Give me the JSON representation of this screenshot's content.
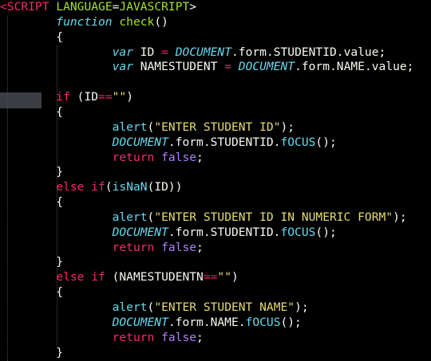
{
  "editor": {
    "theme_colors": {
      "background": "#000000",
      "tag": "#f92672",
      "function": "#a6e22e",
      "storage": "#66d9ef",
      "string": "#e6db74",
      "constant": "#ae81ff",
      "plain": "#f8f8f2",
      "current_line": "#3a3d41"
    },
    "lines": [
      [
        {
          "t": "tag",
          "v": "<SCRIPT"
        },
        {
          "t": "plain",
          "v": " "
        },
        {
          "t": "attr",
          "v": "LANGUAGE"
        },
        {
          "t": "plain",
          "v": "="
        },
        {
          "t": "attr",
          "v": "JAVASCRIPT"
        },
        {
          "t": "plain",
          "v": ">"
        }
      ],
      [
        {
          "t": "plain",
          "v": "        "
        },
        {
          "t": "store",
          "v": "function"
        },
        {
          "t": "plain",
          "v": " "
        },
        {
          "t": "fn",
          "v": "check"
        },
        {
          "t": "plain",
          "v": "()"
        }
      ],
      [
        {
          "t": "plain",
          "v": "        {"
        }
      ],
      [
        {
          "t": "plain",
          "v": "                "
        },
        {
          "t": "store",
          "v": "var"
        },
        {
          "t": "plain",
          "v": " ID "
        },
        {
          "t": "op",
          "v": "="
        },
        {
          "t": "plain",
          "v": " "
        },
        {
          "t": "var",
          "v": "DOCUMENT"
        },
        {
          "t": "plain",
          "v": ".form.STUDENTID.value;"
        }
      ],
      [
        {
          "t": "plain",
          "v": "                "
        },
        {
          "t": "store",
          "v": "var"
        },
        {
          "t": "plain",
          "v": " NAMESTUDENT "
        },
        {
          "t": "op",
          "v": "="
        },
        {
          "t": "plain",
          "v": " "
        },
        {
          "t": "var",
          "v": "DOCUMENT"
        },
        {
          "t": "plain",
          "v": ".form.NAME.value;"
        }
      ],
      [],
      [
        {
          "t": "plain",
          "v": "        "
        },
        {
          "t": "kw",
          "v": "if"
        },
        {
          "t": "plain",
          "v": " (ID"
        },
        {
          "t": "op",
          "v": "=="
        },
        {
          "t": "str",
          "v": "\"\""
        },
        {
          "t": "plain",
          "v": ")"
        }
      ],
      [
        {
          "t": "plain",
          "v": "        {"
        }
      ],
      [
        {
          "t": "plain",
          "v": "                "
        },
        {
          "t": "sup",
          "v": "alert"
        },
        {
          "t": "plain",
          "v": "("
        },
        {
          "t": "str",
          "v": "\"ENTER STUDENT ID\""
        },
        {
          "t": "plain",
          "v": ");"
        }
      ],
      [
        {
          "t": "plain",
          "v": "                "
        },
        {
          "t": "var",
          "v": "DOCUMENT"
        },
        {
          "t": "plain",
          "v": ".form.STUDENTID."
        },
        {
          "t": "sup",
          "v": "fOCUS"
        },
        {
          "t": "plain",
          "v": "();"
        }
      ],
      [
        {
          "t": "plain",
          "v": "                "
        },
        {
          "t": "kw",
          "v": "return"
        },
        {
          "t": "plain",
          "v": " "
        },
        {
          "t": "bool",
          "v": "false"
        },
        {
          "t": "plain",
          "v": ";"
        }
      ],
      [
        {
          "t": "plain",
          "v": "        }"
        }
      ],
      [
        {
          "t": "plain",
          "v": "        "
        },
        {
          "t": "kw",
          "v": "else"
        },
        {
          "t": "plain",
          "v": " "
        },
        {
          "t": "kw",
          "v": "if"
        },
        {
          "t": "plain",
          "v": "("
        },
        {
          "t": "sup",
          "v": "isNaN"
        },
        {
          "t": "plain",
          "v": "(ID))"
        }
      ],
      [
        {
          "t": "plain",
          "v": "        {"
        }
      ],
      [
        {
          "t": "plain",
          "v": "                "
        },
        {
          "t": "sup",
          "v": "alert"
        },
        {
          "t": "plain",
          "v": "("
        },
        {
          "t": "str",
          "v": "\"ENTER STUDENT ID IN NUMERIC FORM\""
        },
        {
          "t": "plain",
          "v": ");"
        }
      ],
      [
        {
          "t": "plain",
          "v": "                "
        },
        {
          "t": "var",
          "v": "DOCUMENT"
        },
        {
          "t": "plain",
          "v": ".form.STUDENTID."
        },
        {
          "t": "sup",
          "v": "fOCUS"
        },
        {
          "t": "plain",
          "v": "();"
        }
      ],
      [
        {
          "t": "plain",
          "v": "                "
        },
        {
          "t": "kw",
          "v": "return"
        },
        {
          "t": "plain",
          "v": " "
        },
        {
          "t": "bool",
          "v": "false"
        },
        {
          "t": "plain",
          "v": ";"
        }
      ],
      [
        {
          "t": "plain",
          "v": "        }"
        }
      ],
      [
        {
          "t": "plain",
          "v": "        "
        },
        {
          "t": "kw",
          "v": "else"
        },
        {
          "t": "plain",
          "v": " "
        },
        {
          "t": "kw",
          "v": "if"
        },
        {
          "t": "plain",
          "v": " (NAMESTUDENTN"
        },
        {
          "t": "op",
          "v": "=="
        },
        {
          "t": "str",
          "v": "\"\""
        },
        {
          "t": "plain",
          "v": ")"
        }
      ],
      [
        {
          "t": "plain",
          "v": "        {"
        }
      ],
      [
        {
          "t": "plain",
          "v": "                "
        },
        {
          "t": "sup",
          "v": "alert"
        },
        {
          "t": "plain",
          "v": "("
        },
        {
          "t": "str",
          "v": "\"ENTER STUDENT NAME\""
        },
        {
          "t": "plain",
          "v": ");"
        }
      ],
      [
        {
          "t": "plain",
          "v": "                "
        },
        {
          "t": "var",
          "v": "DOCUMENT"
        },
        {
          "t": "plain",
          "v": ".form.NAME."
        },
        {
          "t": "sup",
          "v": "fOCUS"
        },
        {
          "t": "plain",
          "v": "();"
        }
      ],
      [
        {
          "t": "plain",
          "v": "                "
        },
        {
          "t": "kw",
          "v": "return"
        },
        {
          "t": "plain",
          "v": " "
        },
        {
          "t": "bool",
          "v": "false"
        },
        {
          "t": "plain",
          "v": ";"
        }
      ],
      [
        {
          "t": "plain",
          "v": "        }"
        }
      ]
    ]
  }
}
